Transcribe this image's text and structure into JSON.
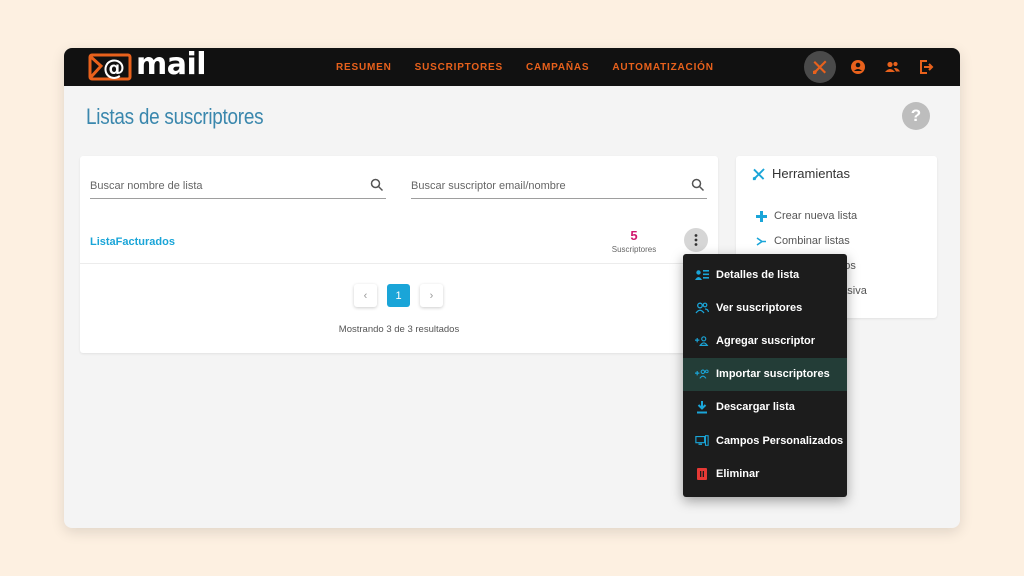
{
  "brand": {
    "name": "mail",
    "accent": "#e8611c"
  },
  "nav": {
    "items": [
      "RESUMEN",
      "SUSCRIPTORES",
      "CAMPAÑAS",
      "AUTOMATIZACIÓN"
    ]
  },
  "top_icons": [
    "tools-icon",
    "user-icon",
    "users-icon",
    "logout-icon"
  ],
  "page": {
    "title": "Listas de suscriptores",
    "help": "?"
  },
  "search": {
    "list_placeholder": "Buscar nombre de lista",
    "subscriber_placeholder": "Buscar suscriptor email/nombre"
  },
  "lists": [
    {
      "name": "ListaFacturados",
      "count": "5",
      "count_label": "Suscriptores"
    }
  ],
  "pagination": {
    "prev": "‹",
    "current": "1",
    "next": "›",
    "summary": "Mostrando 3 de 3 resultados"
  },
  "tools": {
    "title": "Herramientas",
    "items": [
      "Crear nueva lista",
      "Combinar listas",
      "ados",
      "masiva"
    ]
  },
  "menu": {
    "items": [
      {
        "label": "Detalles de lista",
        "icon": "list-details-icon"
      },
      {
        "label": "Ver suscriptores",
        "icon": "view-users-icon"
      },
      {
        "label": "Agregar suscriptor",
        "icon": "add-user-icon"
      },
      {
        "label": "Importar suscriptores",
        "icon": "import-users-icon"
      },
      {
        "label": "Descargar lista",
        "icon": "download-icon"
      },
      {
        "label": "Campos Personalizados",
        "icon": "custom-fields-icon"
      },
      {
        "label": "Eliminar",
        "icon": "trash-icon"
      }
    ],
    "highlighted_index": 3
  },
  "colors": {
    "link": "#1aa5d8",
    "count": "#d0166e",
    "title": "#3a87ad",
    "delete": "#e53935"
  }
}
